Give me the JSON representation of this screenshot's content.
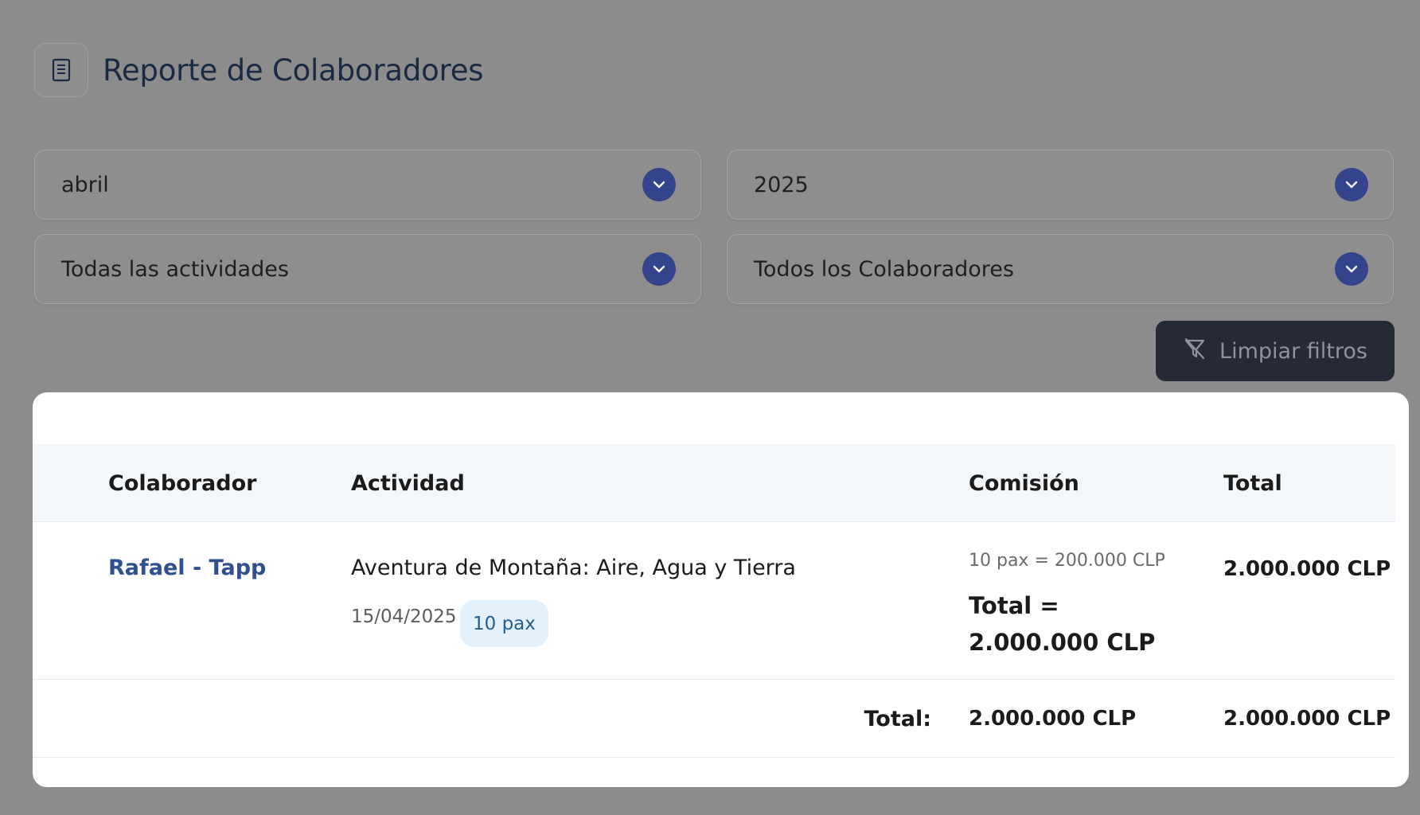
{
  "header": {
    "title": "Reporte de Colaboradores",
    "icon": "document-icon"
  },
  "filters": {
    "month": {
      "value": "abril"
    },
    "year": {
      "value": "2025"
    },
    "activity": {
      "value": "Todas las actividades"
    },
    "collaborator": {
      "value": "Todos los Colaboradores"
    },
    "clear_label": "Limpiar filtros",
    "clear_icon": "filter-off-icon"
  },
  "table": {
    "columns": [
      "Colaborador",
      "Actividad",
      "Comisión",
      "Total"
    ],
    "rows": [
      {
        "collaborator": "Rafael - Tapp",
        "activity": "Aventura de Montaña: Aire, Agua y Tierra",
        "date": "15/04/2025",
        "pax": "10 pax",
        "commission_detail": "10 pax = 200.000 CLP",
        "commission_total": "Total = 2.000.000 CLP",
        "total": "2.000.000 CLP"
      }
    ],
    "footer": {
      "label": "Total:",
      "commission": "2.000.000 CLP",
      "total": "2.000.000 CLP"
    }
  },
  "colors": {
    "accent": "#33438c",
    "link": "#2f4f8f",
    "button_bg": "#262a36",
    "badge_bg": "#e3f1fc"
  }
}
